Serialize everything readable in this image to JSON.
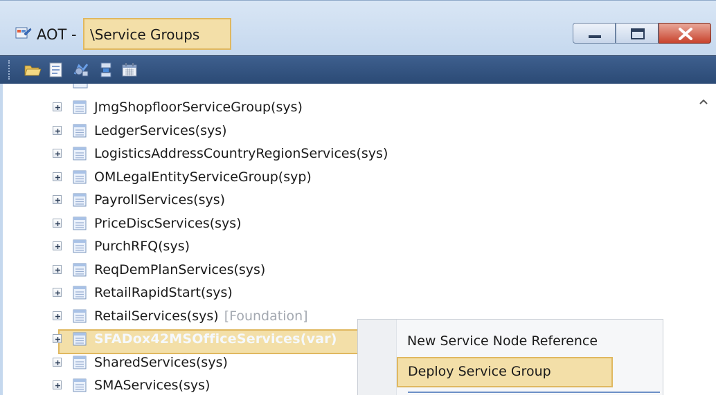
{
  "window": {
    "title_prefix": "AOT -",
    "title_path": "\\Service Groups",
    "app_icon": "aot-window-icon",
    "buttons": {
      "minimize": "minimize-icon",
      "maximize": "maximize-icon",
      "close": "close-icon"
    }
  },
  "toolbar": {
    "icons": [
      "open-folder-icon",
      "properties-icon",
      "compile-icon",
      "import-icon",
      "calendar-icon"
    ]
  },
  "tree": {
    "items": [
      {
        "label": "JmgShopfloorServiceGroup(sys)"
      },
      {
        "label": "LedgerServices(sys)"
      },
      {
        "label": "LogisticsAddressCountryRegionServices(sys)"
      },
      {
        "label": "OMLegalEntityServiceGroup(syp)"
      },
      {
        "label": "PayrollServices(sys)"
      },
      {
        "label": "PriceDiscServices(sys)"
      },
      {
        "label": "PurchRFQ(sys)"
      },
      {
        "label": "ReqDemPlanServices(sys)"
      },
      {
        "label": "RetailRapidStart(sys)"
      },
      {
        "label": "RetailServices(sys)",
        "tag": "[Foundation]"
      },
      {
        "label": "SFADox42MSOfficeServices(var)",
        "selected": true
      },
      {
        "label": "SharedServices(sys)"
      },
      {
        "label": "SMAServices(sys)"
      }
    ]
  },
  "context_menu": {
    "items": [
      {
        "label": "New Service Node Reference"
      },
      {
        "label": "Deploy Service Group",
        "highlighted": true
      }
    ]
  },
  "colors": {
    "highlight_fill": "#f3dfa8",
    "highlight_border": "#e0b860",
    "toolbar_bg": "#3e5f8e",
    "titlebar_bg": "#d9e6f5"
  }
}
